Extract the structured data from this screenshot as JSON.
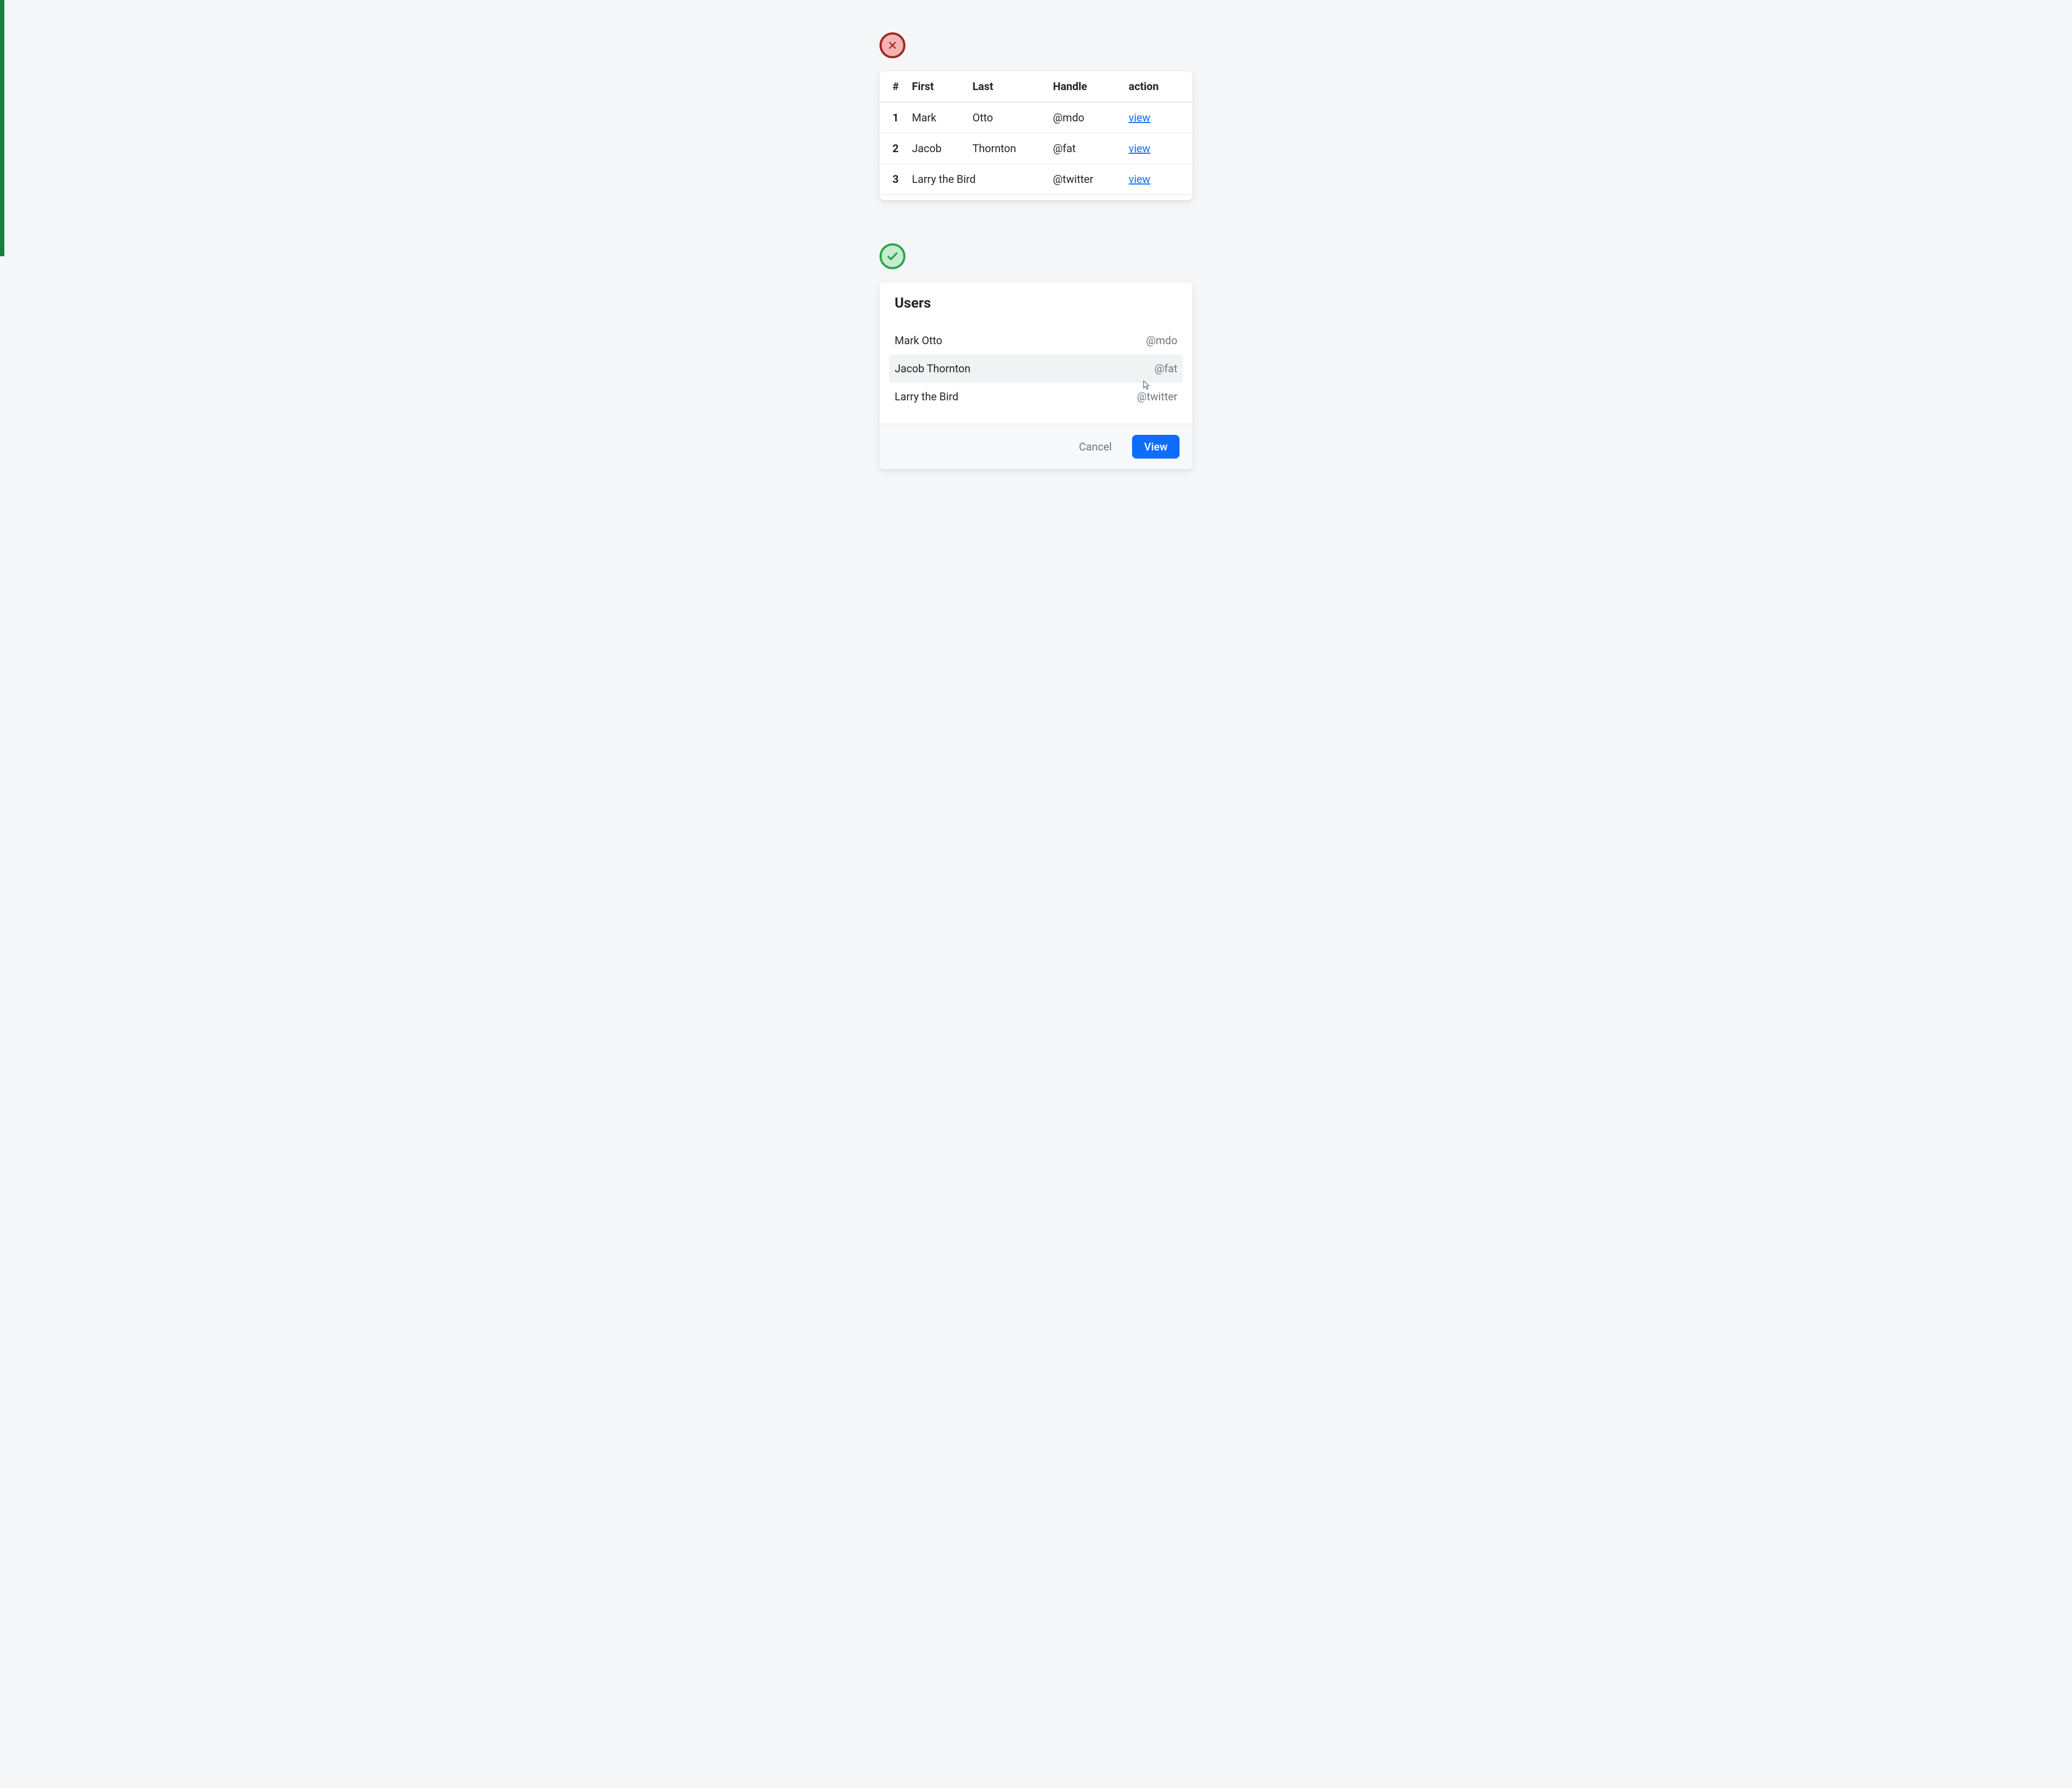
{
  "bad_example": {
    "headers": {
      "idx": "#",
      "first": "First",
      "last": "Last",
      "handle": "Handle",
      "action": "action"
    },
    "rows": [
      {
        "idx": "1",
        "first": "Mark",
        "last": "Otto",
        "handle": "@mdo",
        "action": "view"
      },
      {
        "idx": "2",
        "first": "Jacob",
        "last": "Thornton",
        "handle": "@fat",
        "action": "view"
      },
      {
        "idx": "3",
        "first_span": "Larry the Bird",
        "handle": "@twitter",
        "action": "view"
      }
    ]
  },
  "good_example": {
    "title": "Users",
    "users": [
      {
        "name": "Mark Otto",
        "handle": "@mdo",
        "selected": false
      },
      {
        "name": "Jacob Thornton",
        "handle": "@fat",
        "selected": true
      },
      {
        "name": "Larry the Bird",
        "handle": "@twitter",
        "selected": false
      }
    ],
    "buttons": {
      "cancel": "Cancel",
      "view": "View"
    }
  }
}
